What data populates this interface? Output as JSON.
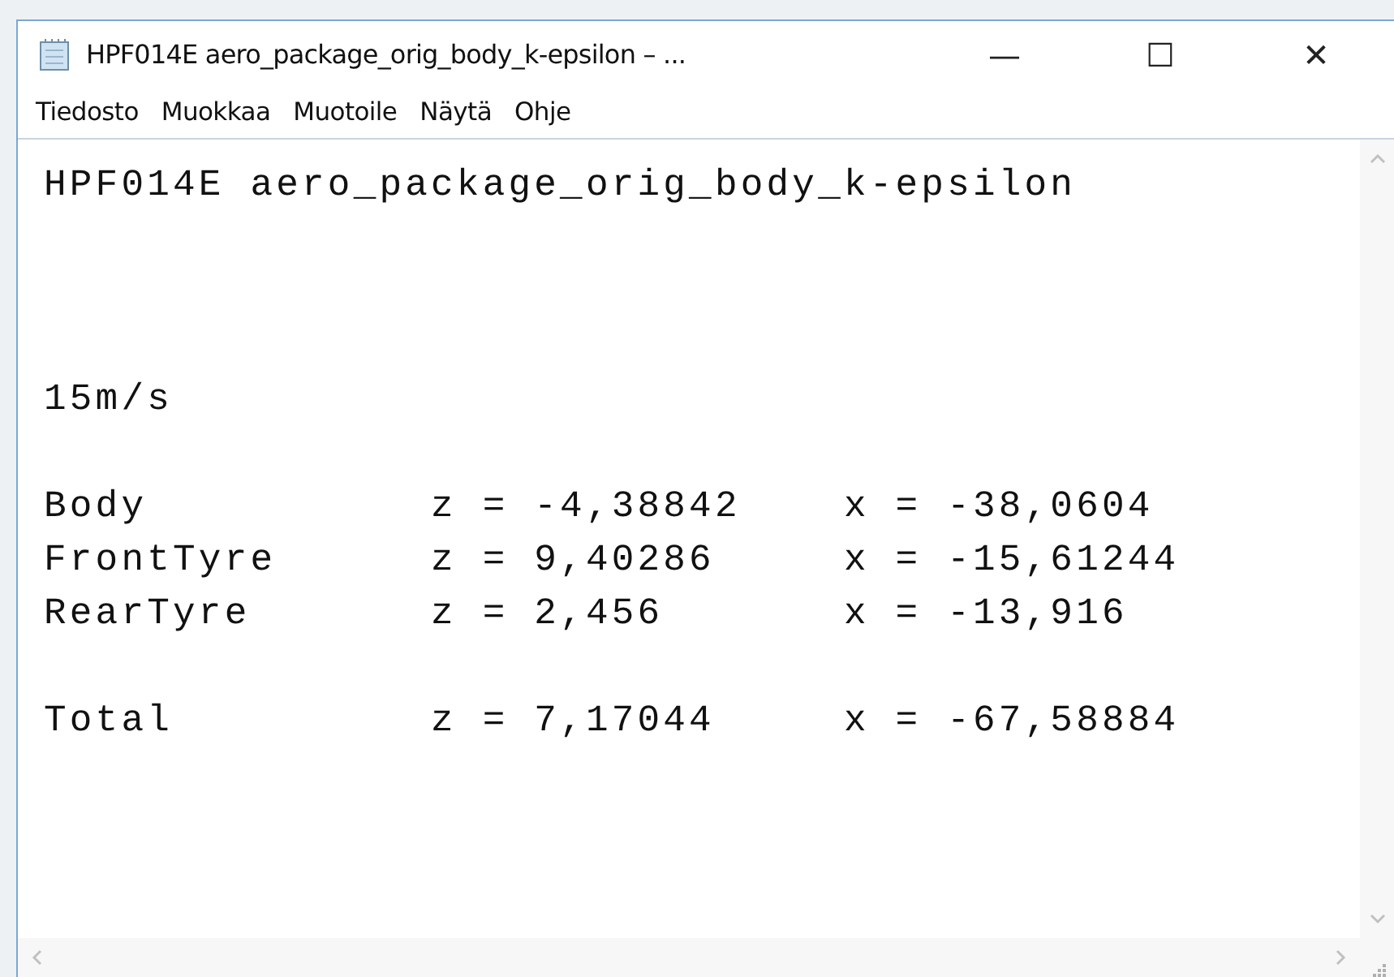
{
  "window": {
    "title": "HPF014E aero_package_orig_body_k-epsilon – ..."
  },
  "window_controls": [
    "—",
    "☐",
    "✕"
  ],
  "menu": [
    "Tiedosto",
    "Muokkaa",
    "Muotoile",
    "Näytä",
    "Ohje"
  ],
  "blocks": [
    {
      "kind": "title",
      "lines": [
        "HPF014E aero_package_orig_body_k-epsilon"
      ]
    },
    {
      "kind": "text",
      "lines": [
        "15m/s"
      ]
    },
    {
      "kind": "text",
      "lines": [
        "Body           z = -4,38842    x = -38,0604",
        "FrontTyre      z = 9,40286     x = -15,61244",
        "RearTyre       z = 2,456       x = -13,916"
      ]
    },
    {
      "kind": "text",
      "lines": [
        "Total          z = 7,17044     x = -67,58884"
      ]
    }
  ]
}
